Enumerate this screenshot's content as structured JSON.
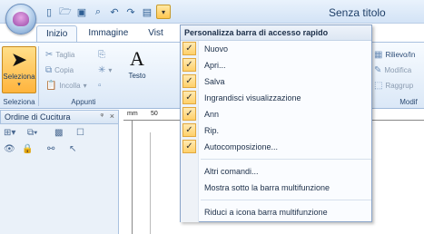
{
  "window": {
    "title": "Senza titolo"
  },
  "qat": {
    "buttons": [
      "new-icon",
      "open-icon",
      "save-icon",
      "zoom-icon",
      "undo-icon",
      "redo-icon",
      "autocompose-icon",
      "customize-qat-icon"
    ]
  },
  "ribbon": {
    "tabs": [
      "Inizio",
      "Immagine",
      "Vist"
    ],
    "select_label": "Seleziona",
    "cut_label": "Taglia",
    "copy_label": "Copia",
    "paste_label": "Incolla",
    "text_label": "Testo",
    "group_select": "Seleziona",
    "group_clipboard": "Appunti",
    "right_items": [
      "Rilievo/In",
      "Modifica",
      "Raggrup"
    ],
    "group_right": "Modif"
  },
  "panel": {
    "title": "Ordine di Cucitura",
    "pin": "ᵠ",
    "close": "×"
  },
  "ruler": {
    "mm_label": "mm",
    "mark_50": "50"
  },
  "menu": {
    "title": "Personalizza barra di accesso rapido",
    "checked_items": [
      "Nuovo",
      "Apri...",
      "Salva",
      "Ingrandisci visualizzazione",
      "Ann",
      "Rip.",
      "Autocomposizione..."
    ],
    "other_commands": "Altri comandi...",
    "show_below": "Mostra sotto la barra multifunzione",
    "minimize": "Riduci a icona barra multifunzione"
  }
}
